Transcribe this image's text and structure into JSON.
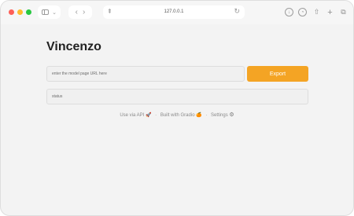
{
  "browser": {
    "url": "127.0.0.1",
    "sidebar_caret": "⌄",
    "back_glyph": "‹",
    "forward_glyph": "›",
    "reader_glyph": "⇞",
    "reload_glyph": "↻",
    "download_glyph": "↓",
    "history_glyph": "◔",
    "share_glyph": "⇧",
    "new_tab_glyph": "+",
    "tabs_glyph": "⧉"
  },
  "app": {
    "title": "Vincenzo",
    "url_placeholder": "enter the model page URL here",
    "export_label": "Export",
    "status_placeholder": "status"
  },
  "footer": {
    "api_label": "Use via API",
    "api_emoji": "🚀",
    "separator": "·",
    "built_with": "Built with Gradio",
    "gradio_logo": "🍊",
    "settings_label": "Settings",
    "settings_icon": "⚙"
  },
  "colors": {
    "accent": "#f4a424",
    "traffic_red": "#fe5f57",
    "traffic_yellow": "#febc2e",
    "traffic_green": "#28c840"
  }
}
